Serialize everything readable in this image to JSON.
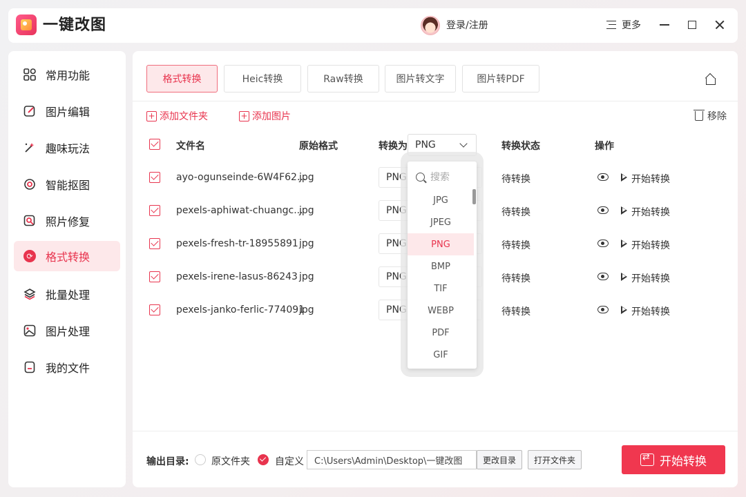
{
  "app": {
    "title": "一键改图"
  },
  "header": {
    "login": "登录/注册",
    "more": "更多"
  },
  "sidebar": {
    "items": [
      {
        "label": "常用功能",
        "icon": "grid-icon"
      },
      {
        "label": "图片编辑",
        "icon": "edit-icon"
      },
      {
        "label": "趣味玩法",
        "icon": "magic-icon"
      },
      {
        "label": "智能抠图",
        "icon": "cutout-icon"
      },
      {
        "label": "照片修复",
        "icon": "repair-icon"
      },
      {
        "label": "格式转换",
        "icon": "convert-icon",
        "active": true
      },
      {
        "label": "批量处理",
        "icon": "layers-icon"
      },
      {
        "label": "图片处理",
        "icon": "image-icon"
      },
      {
        "label": "我的文件",
        "icon": "file-icon"
      }
    ]
  },
  "tabs": [
    {
      "label": "格式转换",
      "active": true
    },
    {
      "label": "Heic转换"
    },
    {
      "label": "Raw转换"
    },
    {
      "label": "图片转文字"
    },
    {
      "label": "图片转PDF"
    }
  ],
  "actions": {
    "add_folder": "添加文件夹",
    "add_image": "添加图片",
    "remove": "移除"
  },
  "table": {
    "headers": {
      "name": "文件名",
      "orig": "原始格式",
      "convert_to": "转换为",
      "status": "转换状态",
      "ops": "操作"
    },
    "target_format": "PNG",
    "rows": [
      {
        "name": "ayo-ogunseinde-6W4F62...",
        "orig": "jpg",
        "fmt": "PNG",
        "status": "待转换",
        "action": "开始转换"
      },
      {
        "name": "pexels-aphiwat-chuangc...",
        "orig": "jpg",
        "fmt": "PNG",
        "status": "待转换",
        "action": "开始转换"
      },
      {
        "name": "pexels-fresh-tr-18955891",
        "orig": "jpg",
        "fmt": "PNG",
        "status": "待转换",
        "action": "开始转换"
      },
      {
        "name": "pexels-irene-lasus-86243",
        "orig": "jpg",
        "fmt": "PNG",
        "status": "待转换",
        "action": "开始转换"
      },
      {
        "name": "pexels-janko-ferlic-774091",
        "orig": "jpg",
        "fmt": "PNG",
        "status": "待转换",
        "action": "开始转换"
      }
    ]
  },
  "dropdown": {
    "search_placeholder": "搜索",
    "options": [
      "JPG",
      "JPEG",
      "PNG",
      "BMP",
      "TIF",
      "WEBP",
      "PDF",
      "GIF"
    ],
    "selected": "PNG"
  },
  "footer": {
    "output_label": "输出目录:",
    "opt_original": "原文件夹",
    "opt_custom": "自定义",
    "path": "C:\\Users\\Admin\\Desktop\\一键改图",
    "change_dir": "更改目录",
    "open_folder": "打开文件夹",
    "start": "开始转换"
  },
  "colors": {
    "accent": "#e8344e",
    "accent_bg": "#fde8ea"
  }
}
